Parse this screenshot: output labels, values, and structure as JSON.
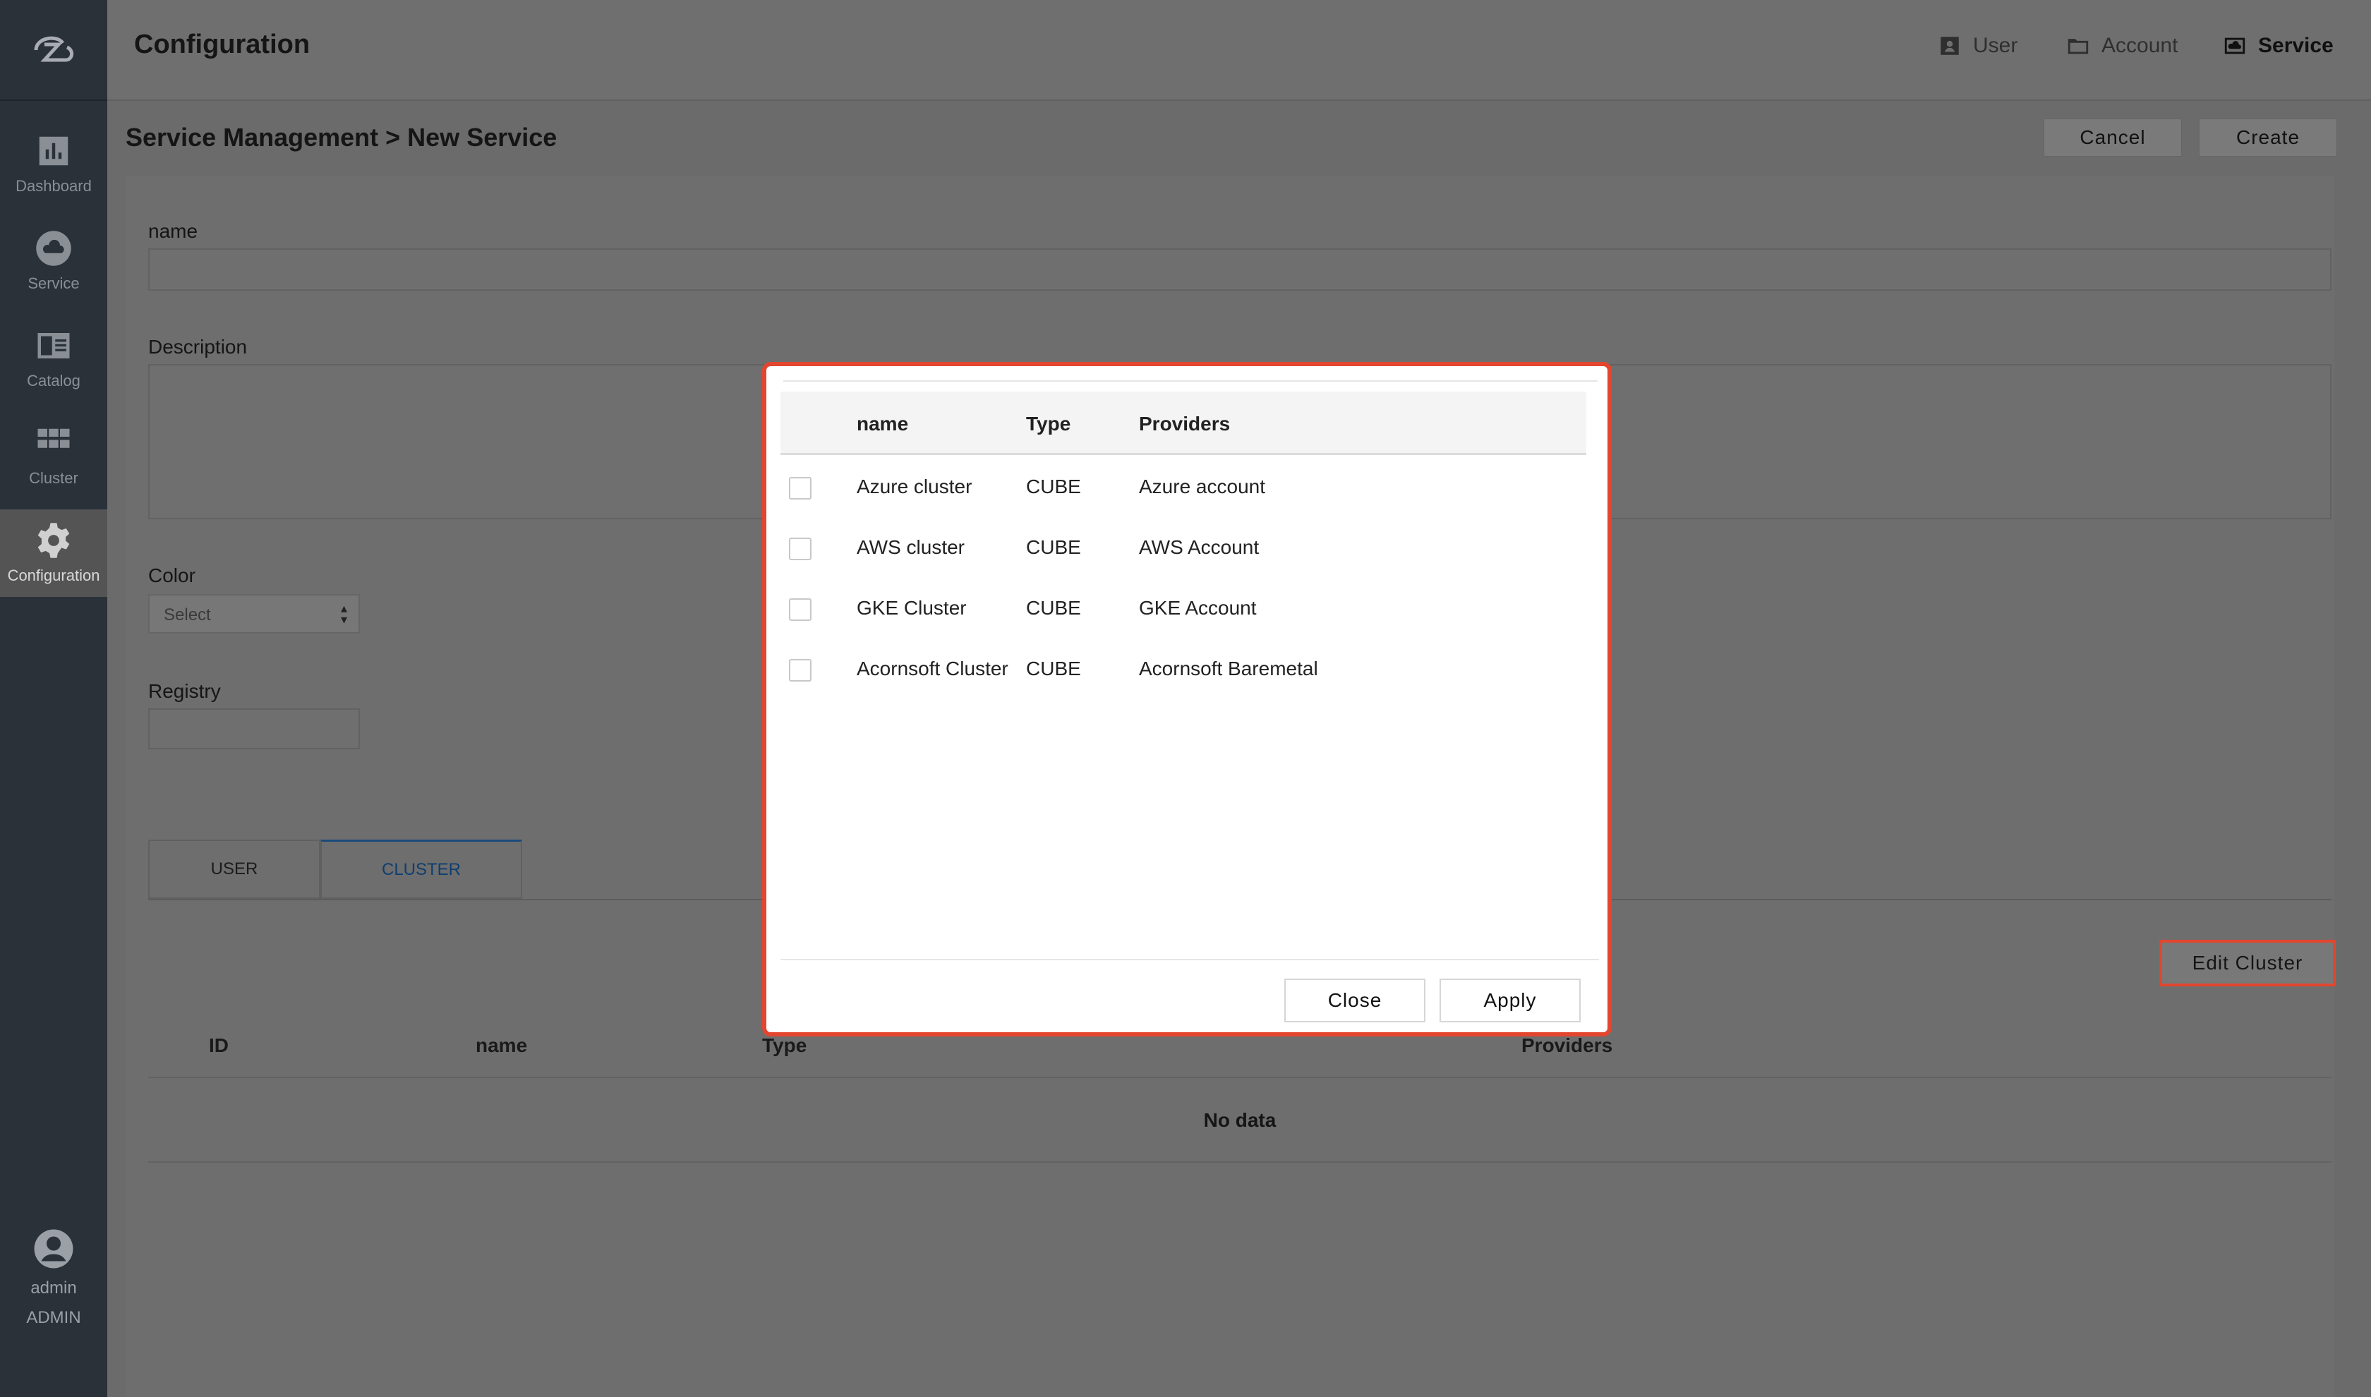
{
  "sidebar": {
    "logo": "logo-icon",
    "items": [
      {
        "label": "Dashboard",
        "icon": "bar-chart-icon"
      },
      {
        "label": "Service",
        "icon": "cloud-icon"
      },
      {
        "label": "Catalog",
        "icon": "catalog-icon"
      },
      {
        "label": "Cluster",
        "icon": "grid-icon"
      },
      {
        "label": "Configuration",
        "icon": "gear-icon",
        "active": true
      }
    ],
    "user": {
      "name": "admin",
      "role": "ADMIN",
      "icon": "user-avatar-icon"
    }
  },
  "header": {
    "title": "Configuration",
    "nav": [
      {
        "label": "User",
        "icon": "user-card-icon"
      },
      {
        "label": "Account",
        "icon": "folder-icon"
      },
      {
        "label": "Service",
        "icon": "cloud-box-icon",
        "active": true
      }
    ]
  },
  "page": {
    "title": "Service Management > New Service",
    "cancel_label": "Cancel",
    "create_label": "Create"
  },
  "form": {
    "name_label": "name",
    "description_label": "Description",
    "color_label": "Color",
    "color_value": "Select",
    "registry_label": "Registry"
  },
  "tabs": [
    {
      "label": "USER"
    },
    {
      "label": "CLUSTER",
      "active": true
    }
  ],
  "cluster_section": {
    "edit_label": "Edit Cluster",
    "columns": [
      "ID",
      "name",
      "Type",
      "Providers"
    ],
    "empty_text": "No data"
  },
  "modal": {
    "columns": [
      "name",
      "Type",
      "Providers"
    ],
    "rows": [
      {
        "name": "Azure cluster",
        "type": "CUBE",
        "provider": "Azure account"
      },
      {
        "name": "AWS cluster",
        "type": "CUBE",
        "provider": "AWS Account"
      },
      {
        "name": "GKE Cluster",
        "type": "CUBE",
        "provider": "GKE Account"
      },
      {
        "name": "Acornsoft Cluster",
        "type": "CUBE",
        "provider": "Acornsoft Baremetal"
      }
    ],
    "close_label": "Close",
    "apply_label": "Apply"
  },
  "colors": {
    "highlight": "#e3452f",
    "sidebar_bg": "#2b3139",
    "overlay": "#6b6b6b"
  }
}
